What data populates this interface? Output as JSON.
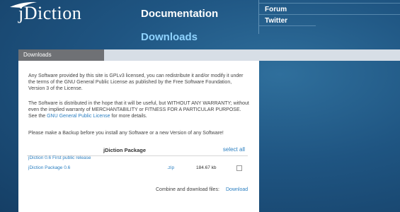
{
  "logo": {
    "text": "jDiction"
  },
  "nav": {
    "documentation": "Documentation",
    "downloads": "Downloads"
  },
  "side_links": [
    "Forum",
    "Twitter"
  ],
  "tab": {
    "label": "Downloads"
  },
  "content": {
    "p1": "Any Software provided by this site is GPLv3 licensed, you can redistribute it and/or modify it under the terms of the GNU General Public License as published by the Free Software Foundation, Version 3 of the License.",
    "p2_pre": "The Software is distributed in the hope that it will be useful, but WITHOUT ANY WARRANTY; without even the implied warranty of MERCHANTABILITY or FITNESS FOR A PARTICULAR PURPOSE. See the ",
    "p2_link": "GNU General Public License",
    "p2_post": " for more details.",
    "p3": "Please make a Backup before you install any Software or a new Version of any Software!"
  },
  "package": {
    "title": "jDiction Package",
    "select_all": "select all",
    "release": "jDiction 0.6 First public release",
    "rows": [
      {
        "name": "jDiction Package 0.6",
        "ext": ".zip",
        "size": "184.67 kb"
      }
    ],
    "combine_label": "Combine and download files:",
    "download_link": "Download"
  }
}
